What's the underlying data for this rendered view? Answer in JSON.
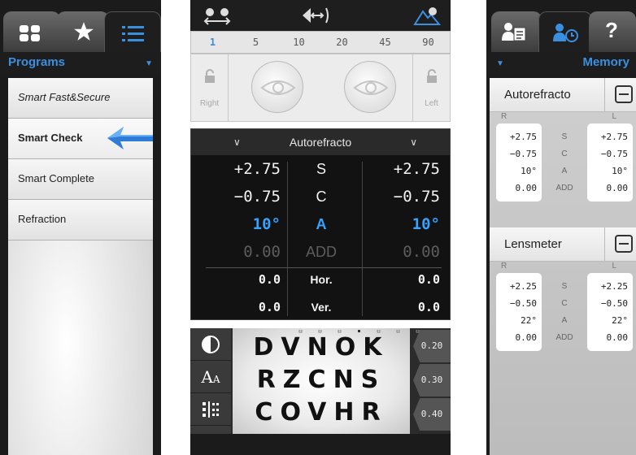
{
  "left_panel": {
    "section_title": "Programs",
    "programs": [
      "Smart Fast&Secure",
      "Smart Check",
      "Smart Complete",
      "Refraction"
    ],
    "selected_program": "Smart Check"
  },
  "middle_panel": {
    "accommodation_steps": [
      "1",
      "5",
      "10",
      "20",
      "45",
      "90"
    ],
    "active_step": "1",
    "eye_labels": {
      "right": "Right",
      "left": "Left"
    },
    "refraction": {
      "title": "Autorefracto",
      "rows": [
        {
          "symbol": "S",
          "right": "+2.75",
          "left": "+2.75"
        },
        {
          "symbol": "C",
          "right": "−0.75",
          "left": "−0.75"
        },
        {
          "symbol": "A",
          "right": "10°",
          "left": "10°"
        },
        {
          "symbol": "ADD",
          "right": "0.00",
          "left": "0.00"
        },
        {
          "symbol": "Hor.",
          "right": "0.0",
          "left": "0.0"
        },
        {
          "symbol": "Ver.",
          "right": "0.0",
          "left": "0.0"
        }
      ]
    },
    "chart": {
      "lines": [
        "DVNOK",
        "RZCNS",
        "COVHR"
      ],
      "acuities": [
        "0.20",
        "0.30",
        "0.40"
      ],
      "tools": [
        "contrast-icon",
        "font-size-icon",
        "pattern-icon"
      ]
    }
  },
  "right_panel": {
    "section_title": "Memory",
    "cards": [
      {
        "title": "Autorefracto",
        "col_r": "R",
        "col_l": "L",
        "symbols": [
          "S",
          "C",
          "A",
          "ADD"
        ],
        "right_values": [
          "+2.75",
          "−0.75",
          "10°",
          "0.00"
        ],
        "left_values": [
          "+2.75",
          "−0.75",
          "10°",
          "0.00"
        ]
      },
      {
        "title": "Lensmeter",
        "col_r": "R",
        "col_l": "L",
        "symbols": [
          "S",
          "C",
          "A",
          "ADD"
        ],
        "right_values": [
          "+2.25",
          "−0.50",
          "22°",
          "0.00"
        ],
        "left_values": [
          "+2.25",
          "−0.50",
          "22°",
          "0.00"
        ]
      }
    ]
  },
  "colors": {
    "accent": "#3b8fe0",
    "axis_blue": "#36a3ff",
    "dark_bg": "#1b1b1b"
  }
}
